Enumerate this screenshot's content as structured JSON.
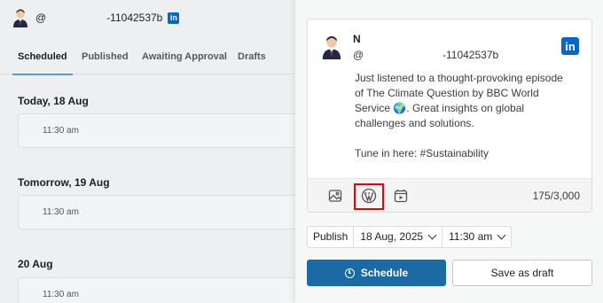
{
  "account": {
    "handle": "@",
    "id": "-11042537b",
    "network_icon": "linkedin-icon"
  },
  "tabs": [
    {
      "label": "Scheduled",
      "active": true
    },
    {
      "label": "Published",
      "active": false
    },
    {
      "label": "Awaiting Approval",
      "active": false
    },
    {
      "label": "Drafts",
      "active": false
    }
  ],
  "schedule": [
    {
      "day": "Today, 18 Aug",
      "time": "11:30 am"
    },
    {
      "day": "Tomorrow, 19 Aug",
      "time": "11:30 am"
    },
    {
      "day": "20 Aug",
      "time": "11:30 am"
    }
  ],
  "preview": {
    "name": "N",
    "handle": "@",
    "id": "-11042537b",
    "text_para1": "Just listened to a thought-provoking episode of The Climate Question by BBC World Service 🌍. Great insights on global challenges and solutions.",
    "text_para2": "Tune in here: #Sustainability",
    "char_count": "175/3,000",
    "toolbar_icons": [
      "image-icon",
      "wordpress-icon",
      "video-icon"
    ]
  },
  "publish": {
    "label": "Publish",
    "date": "18 Aug, 2025",
    "time": "11:30 am"
  },
  "actions": {
    "schedule_label": "Schedule",
    "draft_label": "Save as draft"
  },
  "colors": {
    "primary": "#1b6aa5",
    "linkedin": "#0a66c2",
    "highlight": "#ee0000"
  }
}
